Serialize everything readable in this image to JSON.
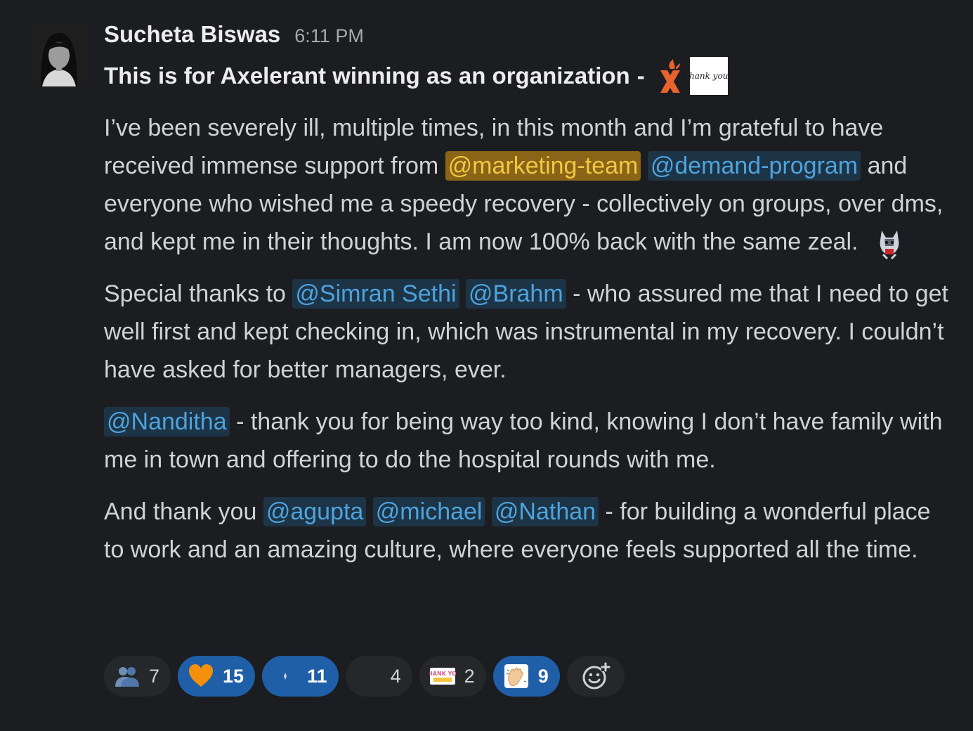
{
  "message": {
    "author": "Sucheta Biswas",
    "timestamp": "6:11 PM",
    "subject": "This is for Axelerant winning as an organization",
    "subject_sep": "-",
    "subject_emojis": [
      "axelerant-logo-icon",
      "thank-you-sticker-icon"
    ],
    "thank_you_sticker_text": "thank you!",
    "paragraphs": {
      "p1": {
        "t1": "I’ve been severely ill, multiple times, in this month and I’m grateful to have received immense support from ",
        "m1": "@marketing-team",
        "m2": "@demand-program",
        "t2": " and everyone who wished me a speedy recovery - collectively on groups, over dms, and kept me in their thoughts. I am now 100% back with the same zeal.",
        "emoji": "husky-dog-icon"
      },
      "p2": {
        "t1": "Special thanks to ",
        "m1": "@Simran Sethi",
        "m2": "@Brahm",
        "t2": " - who assured me that I need to get well first and kept checking in, which was instrumental in my recovery. I couldn’t have asked for better managers, ever."
      },
      "p3": {
        "m1": "@Nanditha",
        "t1": " - thank you for being way too kind, knowing I don’t have family with me  in town and offering to do the hospital rounds with me."
      },
      "p4": {
        "t1": "And thank you ",
        "m1": "@agupta",
        "m2": "@michael",
        "m3": "@Nathan",
        "t2": " - for building a wonderful place to work and an amazing culture, where everyone feels supported all the time."
      }
    }
  },
  "reactions": [
    {
      "emoji": "people-hugging-icon",
      "count": "7",
      "active": false
    },
    {
      "emoji": "orange-heart-icon",
      "count": "15",
      "active": true
    },
    {
      "emoji": "sparkle-icon",
      "count": "11",
      "active": true
    },
    {
      "emoji": "blank-custom-emoji-icon",
      "count": "4",
      "active": false
    },
    {
      "emoji": "thank-you-badge-icon",
      "count": "2",
      "active": false,
      "label": "THANK YOU"
    },
    {
      "emoji": "clapping-hands-icon",
      "count": "9",
      "active": true
    }
  ],
  "add_reaction": "add-reaction-icon",
  "colors": {
    "background": "#1b1d21",
    "text": "#d1d2d3",
    "mention_bg": "#1d3447",
    "mention_text": "#4ea3dd",
    "highlight_bg": "#8a6417",
    "highlight_text": "#f2c744",
    "active_reaction": "#1f5fa8"
  }
}
